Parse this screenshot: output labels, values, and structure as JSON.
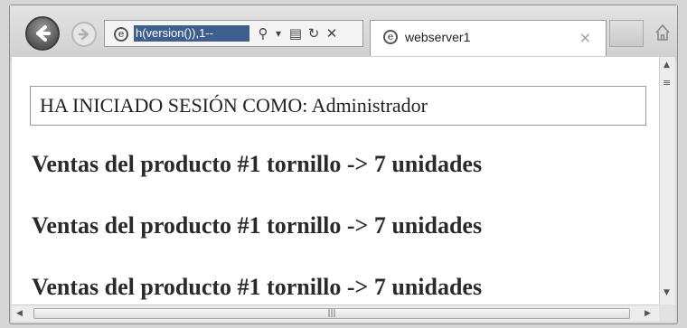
{
  "browser": {
    "address_text": "h(version()),1--",
    "tab_title": "webserver1",
    "tab_close": "×",
    "search_glyph": "⚲",
    "dropdown_glyph": "▾",
    "compat_glyph": "▤",
    "refresh_glyph": "↻",
    "stop_glyph": "✕",
    "hscroll_grip": "|||",
    "menu_glyph": "≡"
  },
  "page": {
    "session_text": "HA INICIADO SESIÓN COMO: Administrador",
    "sales_lines": [
      "Ventas del producto #1 tornillo -> 7 unidades",
      "Ventas del producto #1 tornillo -> 7 unidades",
      "Ventas del producto #1 tornillo -> 7 unidades"
    ]
  },
  "colors": {
    "address_highlight": "#3d5f8e",
    "chrome": "#d9d9d9"
  }
}
